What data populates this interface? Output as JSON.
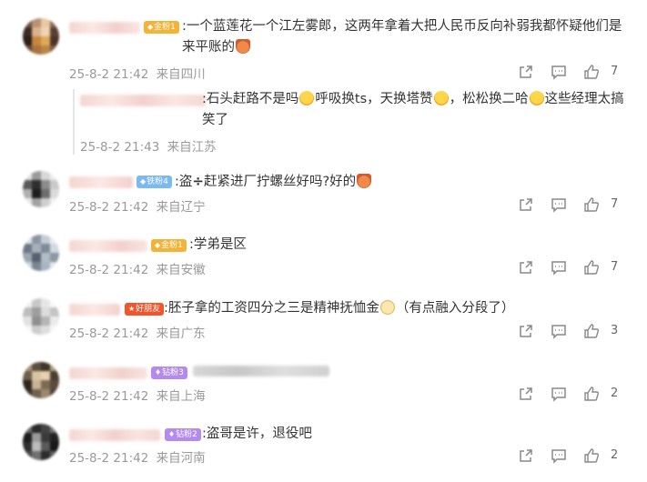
{
  "comments": [
    {
      "badge": "金粉1",
      "text": ":一个蓝莲花一个江左雾郎，这两年拿着大把人民币反向补弱我都怀疑他们是来平账的",
      "emoji": "money-bag-emoji",
      "time": "25-8-2 21:42",
      "location": "来自四川",
      "likes": "7",
      "reply": {
        "text_parts": [
          ":石头赶路不是吗",
          "呼吸换ts，天换塔赞",
          "，松松换二哈",
          "这些经理太搞笑了"
        ],
        "time": "25-8-2 21:43",
        "location": "来自江苏"
      }
    },
    {
      "badge": "铁粉4",
      "text_parts": [
        ":盗",
        "赶紧进厂拧螺丝好吗?好的"
      ],
      "time": "25-8-2 21:42",
      "location": "来自辽宁",
      "likes": "7"
    },
    {
      "badge": "金粉1",
      "text": ":学弟是区",
      "time": "25-8-2 21:42",
      "location": "来自安徽",
      "likes": "7"
    },
    {
      "badge": "好朋友",
      "text_parts": [
        ":胚子拿的工资四分之三是精神抚恤金",
        "（有点融入分段了）"
      ],
      "time": "25-8-2 21:42",
      "location": "来自广东",
      "likes": "3"
    },
    {
      "badge": "钻粉3",
      "text": "",
      "time": "25-8-2 21:42",
      "location": "来自上海",
      "likes": "2"
    },
    {
      "badge": "钻粉2",
      "text": ":盗哥是许，退役吧",
      "time": "25-8-2 21:42",
      "location": "来自河南",
      "likes": "2"
    }
  ],
  "icons": {
    "share": "share-icon",
    "comment": "comment-icon",
    "like": "thumbs-up-icon"
  },
  "colors": {
    "text": "#333333",
    "meta": "#999999",
    "gold_badge": "#f5b335",
    "iron_badge": "#7cb8f2",
    "diamond_badge": "#b58af0",
    "friend_badge": "#f2552c"
  }
}
